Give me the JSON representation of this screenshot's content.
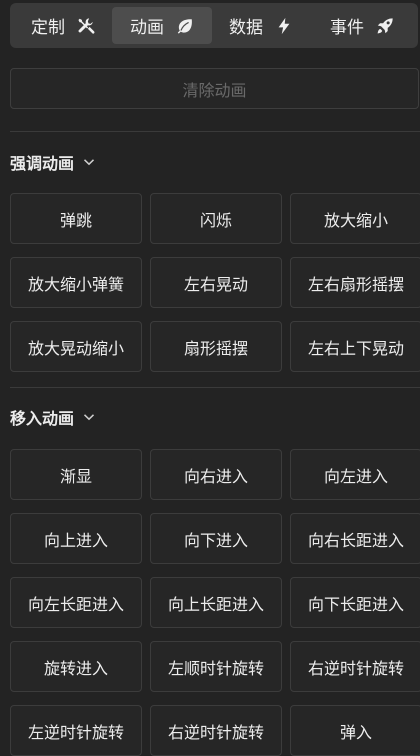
{
  "tabs": [
    {
      "label": "定制",
      "icon": "tools-icon"
    },
    {
      "label": "动画",
      "icon": "leaf-icon"
    },
    {
      "label": "数据",
      "icon": "lightning-icon"
    },
    {
      "label": "事件",
      "icon": "rocket-icon"
    }
  ],
  "active_tab": "动画",
  "clear_label": "清除动画",
  "emphasis": {
    "title": "强调动画",
    "items": [
      "弹跳",
      "闪烁",
      "放大缩小",
      "放大缩小弹簧",
      "左右晃动",
      "左右扇形摇摆",
      "放大晃动缩小",
      "扇形摇摆",
      "左右上下晃动"
    ]
  },
  "move_in": {
    "title": "移入动画",
    "items": [
      "渐显",
      "向右进入",
      "向左进入",
      "向上进入",
      "向下进入",
      "向右长距进入",
      "向左长距进入",
      "向上长距进入",
      "向下长距进入",
      "旋转进入",
      "左顺时针旋转",
      "右逆时针旋转",
      "左逆时针旋转",
      "右逆时针旋转",
      "弹入"
    ]
  },
  "colors": {
    "background": "#232323",
    "tabbar": "#3a3a3a",
    "active_tab": "#4d4d4d",
    "button_border": "#3c3c3c",
    "disabled_text": "#6a6a6a"
  }
}
